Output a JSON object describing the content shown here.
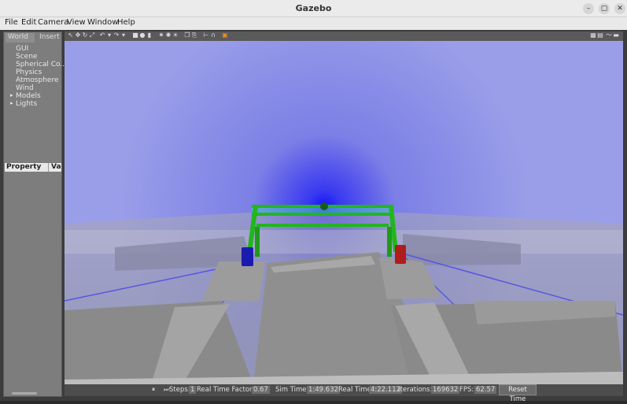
{
  "window": {
    "title": "Gazebo",
    "minimize": "–",
    "maximize": "▢",
    "close": "✕"
  },
  "menubar": [
    "File",
    "Edit",
    "Camera",
    "View",
    "Window",
    "Help"
  ],
  "left_panel": {
    "tabs": [
      "World",
      "Insert"
    ],
    "tree": [
      "GUI",
      "Scene",
      "Spherical Co...",
      "Physics",
      "Atmosphere",
      "Wind",
      "Models",
      "Lights"
    ],
    "property_header": {
      "property": "Property",
      "value": "Va"
    }
  },
  "status": {
    "pause_icon": "⏸",
    "steps_label": "Steps:",
    "steps_value": "1",
    "rtf_label": "Real Time Factor:",
    "rtf_value": "0.67",
    "sim_time_label": "Sim Time:",
    "sim_time_value": "1:49.632",
    "real_time_label": "Real Time:",
    "real_time_value": "4:22.112",
    "iterations_label": "Iterations:",
    "iterations_value": "169632",
    "fps_label": "FPS:",
    "fps_value": "62.57",
    "reset_label": "Reset Time"
  },
  "colors": {
    "sky": "#8c8ee6",
    "ground": "#9a9a9a",
    "robot_frame": "#22b61e",
    "left_wheel": "#1b1bb0",
    "right_wheel": "#b01b1b"
  }
}
